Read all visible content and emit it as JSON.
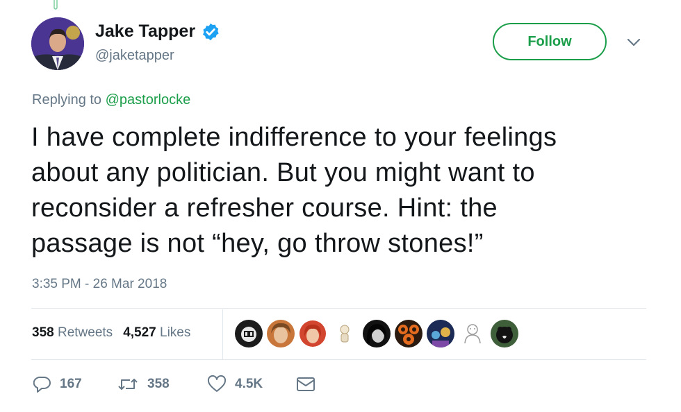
{
  "author": {
    "display_name": "Jake Tapper",
    "handle": "@jaketapper",
    "verified": true,
    "avatar_icon": "user-avatar-photo",
    "verified_icon": "verified-badge-icon"
  },
  "follow_button": {
    "label": "Follow",
    "color": "#1b9e4a"
  },
  "menu": {
    "icon": "chevron-down-icon"
  },
  "reply_context": {
    "prefix": "Replying to ",
    "mention": "@pastorlocke"
  },
  "tweet": {
    "text": "I have complete indifference to your feelings\nabout any politician.  But you might want to\nreconsider a refresher course. Hint: the\npassage is not “hey, go throw stones!”",
    "timestamp": "3:35 PM - 26 Mar 2018"
  },
  "stats": {
    "retweets_count": "358",
    "retweets_label": "Retweets",
    "likes_count": "4,527",
    "likes_label": "Likes"
  },
  "liker_avatars": [
    "liker-avatar-1",
    "liker-avatar-2",
    "liker-avatar-3",
    "liker-avatar-4",
    "liker-avatar-5",
    "liker-avatar-6",
    "liker-avatar-7",
    "liker-avatar-8",
    "liker-avatar-9"
  ],
  "actions": {
    "reply_icon": "reply-icon",
    "reply_count": "167",
    "retweet_icon": "retweet-icon",
    "retweet_count": "358",
    "like_icon": "heart-icon",
    "like_count": "4.5K",
    "dm_icon": "envelope-icon"
  },
  "colors": {
    "accent_green": "#1b9e4a",
    "verified_blue": "#1da1f2",
    "secondary_text": "#657786",
    "divider": "#e1e8ed"
  }
}
